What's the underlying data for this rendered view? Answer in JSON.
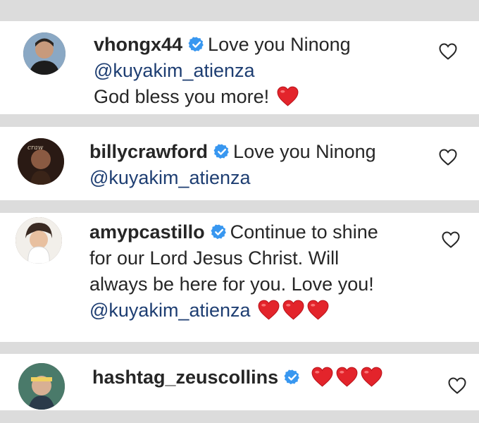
{
  "comments": [
    {
      "username": "vhongx44",
      "verified": true,
      "lines": [
        "Love you Ninong"
      ],
      "mention": "@kuyakim_atienza",
      "after_mention": "God bless you more!",
      "hearts": 1,
      "avatar_icon": "avatar-photo"
    },
    {
      "username": "billycrawford",
      "verified": true,
      "lines": [
        "Love you Ninong"
      ],
      "mention": "@kuyakim_atienza",
      "hearts": 0,
      "avatar_icon": "avatar-photo"
    },
    {
      "username": "amypcastillo",
      "verified": true,
      "line1": "Continue to shine",
      "line2": "for our Lord Jesus Christ. Will",
      "line3": "always be here for you. Love you!",
      "mention": "@kuyakim_atienza",
      "hearts": 3,
      "avatar_icon": "avatar-photo"
    },
    {
      "username": "hashtag_zeuscollins",
      "verified": true,
      "hearts": 3,
      "avatar_icon": "avatar-photo"
    }
  ],
  "icons": {
    "verified": "verified-badge-icon",
    "like": "heart-outline-icon",
    "heart_emoji": "red-heart-emoji"
  },
  "colors": {
    "verified_blue": "#3897f0",
    "mention": "#1e3e72",
    "heart_red": "#e3242b"
  }
}
